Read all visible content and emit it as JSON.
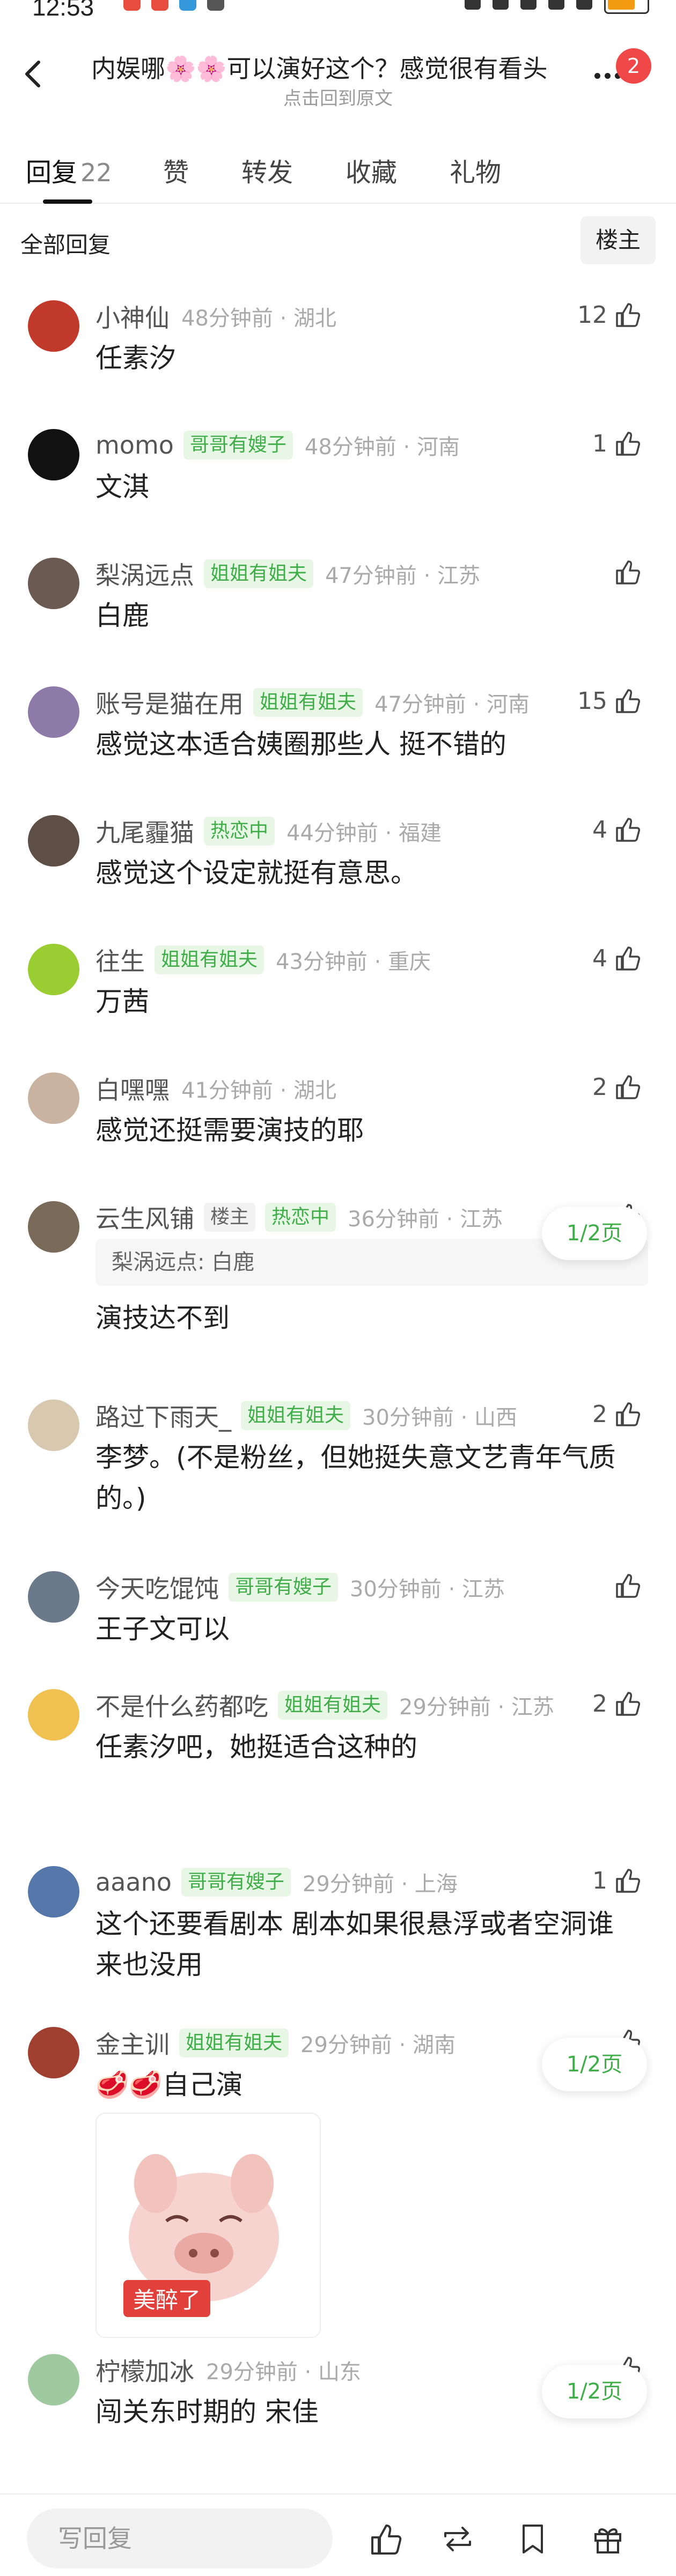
{
  "status_bar": {
    "time": "12:53"
  },
  "header": {
    "title": "内娱哪🌸🌸可以演好这个？感觉很有看头",
    "subtitle": "点击回到原文",
    "badge": "2"
  },
  "tabs": [
    {
      "label": "回复",
      "count": "22"
    },
    {
      "label": "赞"
    },
    {
      "label": "转发"
    },
    {
      "label": "收藏"
    },
    {
      "label": "礼物"
    }
  ],
  "section": {
    "title": "全部回复",
    "owner_button": "楼主"
  },
  "comments": [
    {
      "name": "小神仙",
      "tag": "",
      "meta": "48分钟前 · 湖北",
      "text": "任素汐",
      "likes": "12",
      "avatar_color": "#c0392b"
    },
    {
      "name": "momo",
      "tag": "哥哥有嫂子",
      "meta": "48分钟前 · 河南",
      "text": "文淇",
      "likes": "1",
      "avatar_color": "#111111"
    },
    {
      "name": "梨涡远点",
      "tag": "姐姐有姐夫",
      "meta": "47分钟前 · 江苏",
      "text": "白鹿",
      "likes": "",
      "avatar_color": "#6b5a52"
    },
    {
      "name": "账号是猫在用",
      "tag": "姐姐有姐夫",
      "meta": "47分钟前 · 河南",
      "text": "感觉这本适合姨圈那些人 挺不错的",
      "likes": "15",
      "avatar_color": "#8e7aa8"
    },
    {
      "name": "九尾霾猫",
      "tag": "热恋中",
      "meta": "44分钟前 · 福建",
      "text": "感觉这个设定就挺有意思。",
      "likes": "4",
      "avatar_color": "#5d4f45"
    },
    {
      "name": "往生",
      "tag": "姐姐有姐夫",
      "meta": "43分钟前 · 重庆",
      "text": "万茜",
      "likes": "4",
      "avatar_color": "#9acd32"
    },
    {
      "name": "白嘿嘿",
      "tag": "",
      "meta": "41分钟前 · 湖北",
      "text": "感觉还挺需要演技的耶",
      "likes": "2",
      "avatar_color": "#c9b3a0"
    },
    {
      "name": "云生风铺",
      "tag": "热恋中",
      "owner_tag": "楼主",
      "meta": "36分钟前 · 江苏",
      "quote": "梨涡远点: 白鹿",
      "text": "演技达不到",
      "likes": "",
      "pager": "1/2页",
      "avatar_color": "#7a6a5a"
    },
    {
      "name": "路过下雨天_",
      "tag": "姐姐有姐夫",
      "meta": "30分钟前 · 山西",
      "text": "李梦。(不是粉丝，但她挺失意文艺青年气质的。)",
      "likes": "2",
      "avatar_color": "#d8c8b0"
    },
    {
      "name": "今天吃馄饨",
      "tag": "哥哥有嫂子",
      "meta": "30分钟前 · 江苏",
      "text": "王子文可以",
      "likes": "",
      "avatar_color": "#6a7a8a"
    },
    {
      "name": "不是什么药都吃",
      "tag": "姐姐有姐夫",
      "meta": "29分钟前 · 江苏",
      "text": "任素汐吧，她挺适合这种的",
      "likes": "2",
      "avatar_color": "#f0c050"
    },
    {
      "name": "aaano",
      "tag": "哥哥有嫂子",
      "meta": "29分钟前 · 上海",
      "text": "这个还要看剧本 剧本如果很悬浮或者空洞谁来也没用",
      "likes": "1",
      "avatar_color": "#5577aa"
    },
    {
      "name": "金主训",
      "tag": "姐姐有姐夫",
      "meta": "29分钟前 · 湖南",
      "text": "🥩🥩自己演",
      "sticker_caption": "美醉了",
      "likes": "",
      "pager": "1/2页",
      "avatar_color": "#a04030"
    },
    {
      "name": "柠檬加冰",
      "tag": "",
      "meta": "29分钟前 · 山东",
      "text": "闯关东时期的 宋佳",
      "likes": "",
      "pager": "1/2页",
      "avatar_color": "#9fc99f"
    }
  ],
  "bottom_bar": {
    "reply_placeholder": "写回复"
  }
}
